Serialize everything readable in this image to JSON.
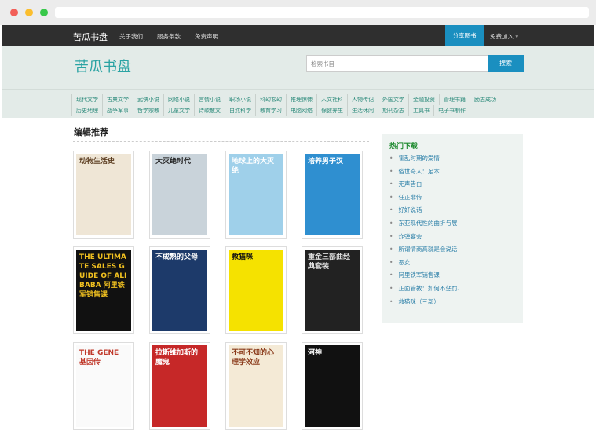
{
  "nav": {
    "brand": "苦瓜书盘",
    "links": [
      "关于我们",
      "服务条款",
      "免责声明"
    ],
    "share": "分享图书",
    "join": "免费加入",
    "join_icon": "caret-down"
  },
  "header": {
    "logo": "苦瓜书盘",
    "search_placeholder": "检索书目",
    "search_button": "搜索"
  },
  "categories": [
    "现代文学",
    "古典文学",
    "武侠小说",
    "网络小说",
    "言情小说",
    "职场小说",
    "科幻玄幻",
    "推理惊悚",
    "人文社科",
    "人物传记",
    "外国文学",
    "金融投资",
    "管理书籍",
    "励志成功",
    "历史地理",
    "战争军事",
    "哲学宗教",
    "儿童文学",
    "诗歌散文",
    "自然科学",
    "教育学习",
    "电脑网络",
    "保健养生",
    "生活休闲",
    "期刊杂志",
    "工具书",
    "电子书制作"
  ],
  "section_title": "编辑推荐",
  "books": [
    {
      "title": "动物生活史",
      "bg": "#efe6d6",
      "fg": "#5a3b1e"
    },
    {
      "title": "大灭绝时代",
      "bg": "#c9d3da",
      "fg": "#222"
    },
    {
      "title": "地球上的大灭绝",
      "bg": "#9fd0ea",
      "fg": "#fff"
    },
    {
      "title": "培养男子汉",
      "bg": "#2f8fd0",
      "fg": "#fff"
    },
    {
      "title": "THE ULTIMATE SALES GUIDE OF ALIBABA 阿里铁军销售课",
      "bg": "#111",
      "fg": "#f0c020"
    },
    {
      "title": "不成熟的父母",
      "bg": "#1d3a6a",
      "fg": "#fff"
    },
    {
      "title": "救猫咪",
      "bg": "#f5e200",
      "fg": "#111"
    },
    {
      "title": "重金三部曲经典套装",
      "bg": "#222",
      "fg": "#ddd"
    },
    {
      "title": "THE GENE 基因传",
      "bg": "#fafafa",
      "fg": "#c0392b"
    },
    {
      "title": "拉斯维加斯的魔鬼",
      "bg": "#c62828",
      "fg": "#fff"
    },
    {
      "title": "不可不知的心理学效应",
      "bg": "#f4ead6",
      "fg": "#8a3a1a"
    },
    {
      "title": "河神",
      "bg": "#111",
      "fg": "#fff"
    }
  ],
  "hot": {
    "title": "热门下载",
    "items": [
      "霍乱时期的爱情",
      "俗世奇人：足本",
      "无声告白",
      "任正非传",
      "好好说话",
      "东亚现代性的曲折与展",
      "炸弹宴会",
      "所谓情商高就是会说话",
      "恶女",
      "阿里铁军销售课",
      "正面管教：如何不惩罚、",
      "救猫咪（三部）"
    ]
  },
  "colors": {
    "accent": "#1a8fc0",
    "logo": "#2aa3a3",
    "nav_bg": "#2f2f2f"
  }
}
